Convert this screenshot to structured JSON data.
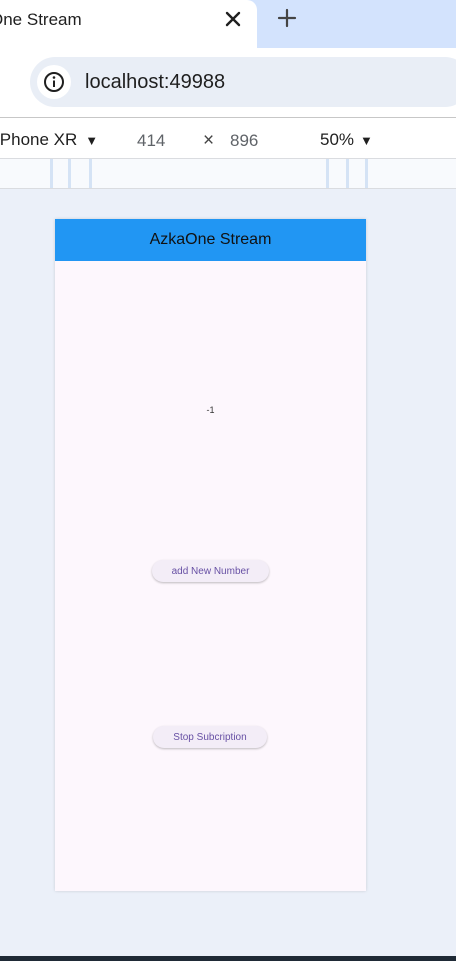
{
  "browser": {
    "tab": {
      "title": "One Stream"
    },
    "address_bar": {
      "url": "localhost:49988"
    },
    "device_toolbar": {
      "device": "iPhone XR",
      "width": "414",
      "times": "×",
      "height": "896",
      "zoom": "50%"
    }
  },
  "app": {
    "title": "AzkaOne Stream",
    "counter": "-1",
    "add_button_label": "add New Number",
    "stop_button_label": "Stop Subcription"
  },
  "colors": {
    "appbar": "#2196f3",
    "button_text": "#6750a4",
    "background": "#ebf0f9"
  }
}
